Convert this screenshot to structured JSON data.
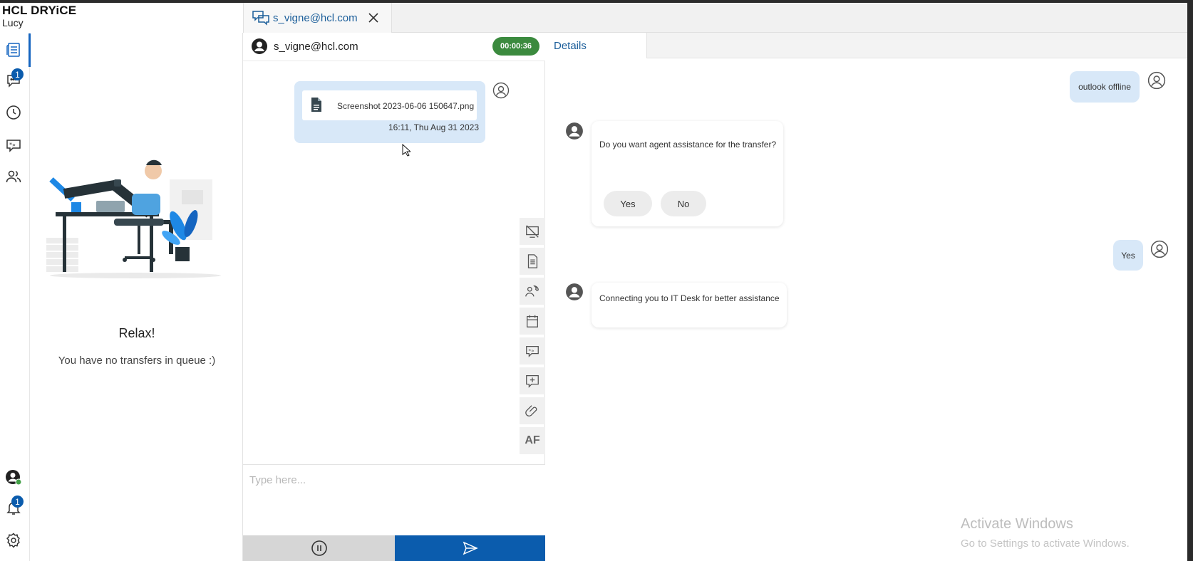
{
  "brand": {
    "name": "HCL DRYiCE",
    "product": "Lucy"
  },
  "rail": {
    "chat_badge": "1",
    "notifications_badge": "1",
    "colors": {
      "accent": "#1565c0",
      "badge": "#0b5cad",
      "online": "#43a047"
    }
  },
  "queue": {
    "title": "Relax!",
    "message": "You have no transfers in queue :)"
  },
  "tab": {
    "label": "s_vigne@hcl.com"
  },
  "chat": {
    "user": "s_vigne@hcl.com",
    "timer": "00:00:36",
    "file_name": "Screenshot 2023-06-06 150647.png",
    "file_time": "16:11, Thu Aug 31 2023",
    "input_placeholder": "Type here...",
    "tools": [
      "stop-screenshare-icon",
      "document-icon",
      "transfer-call-icon",
      "calendar-icon",
      "canned-response-icon",
      "add-comment-icon",
      "attachment-icon",
      "AF"
    ]
  },
  "details": {
    "tab_label": "Details",
    "messages": [
      {
        "from": "user",
        "text": "outlook offline"
      },
      {
        "from": "bot",
        "text": "Do you want agent assistance for the transfer?",
        "options": [
          "Yes",
          "No"
        ]
      },
      {
        "from": "user",
        "text": "Yes"
      },
      {
        "from": "bot",
        "text": "Connecting you to IT Desk for better assistance"
      }
    ]
  },
  "watermark": {
    "line1": "Activate Windows",
    "line2": "Go to Settings to activate Windows."
  }
}
